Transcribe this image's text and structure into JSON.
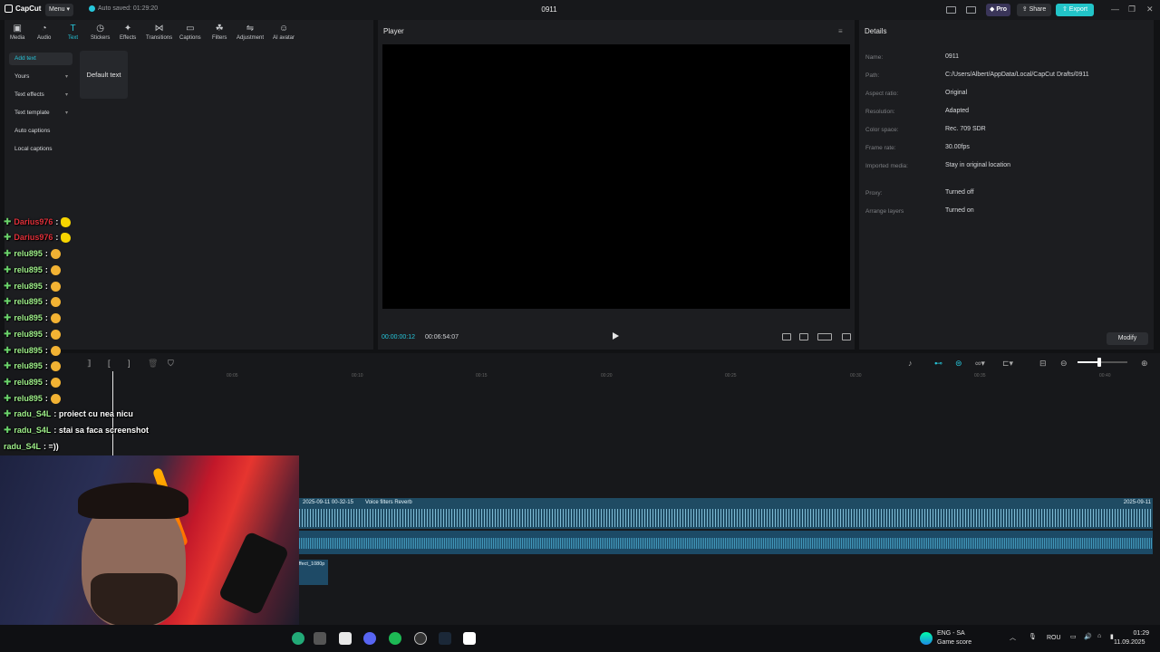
{
  "titlebar": {
    "app_name": "CapCut",
    "menu_label": "Menu",
    "autosave": "Auto saved: 01:29:20",
    "project_title": "0911",
    "pro_label": "Pro",
    "share_label": "Share",
    "export_label": "Export"
  },
  "toolbar": {
    "tabs": [
      {
        "label": "Media",
        "icon": "media-icon"
      },
      {
        "label": "Audio",
        "icon": "audio-icon"
      },
      {
        "label": "Text",
        "icon": "text-icon"
      },
      {
        "label": "Stickers",
        "icon": "stickers-icon"
      },
      {
        "label": "Effects",
        "icon": "effects-icon"
      },
      {
        "label": "Transitions",
        "icon": "transitions-icon"
      },
      {
        "label": "Captions",
        "icon": "captions-icon"
      },
      {
        "label": "Filters",
        "icon": "filters-icon"
      },
      {
        "label": "Adjustment",
        "icon": "adjustment-icon"
      },
      {
        "label": "AI avatar",
        "icon": "ai-avatar-icon"
      }
    ],
    "active_tab": "Text"
  },
  "sidebar": {
    "items": [
      {
        "label": "Add text",
        "selected": true
      },
      {
        "label": "Yours",
        "has_chevron": true
      },
      {
        "label": "Text effects",
        "has_chevron": true
      },
      {
        "label": "Text template",
        "has_chevron": true
      },
      {
        "label": "Auto captions"
      },
      {
        "label": "Local captions"
      }
    ]
  },
  "text_library": {
    "default_text_label": "Default text"
  },
  "player": {
    "title": "Player",
    "current_time": "00:00:00:12",
    "duration": "00:06:54:07"
  },
  "details": {
    "title": "Details",
    "rows": [
      {
        "label": "Name:",
        "value": "0911"
      },
      {
        "label": "Path:",
        "value": "C:/Users/Albert/AppData/Local/CapCut Drafts/0911"
      },
      {
        "label": "Aspect ratio:",
        "value": "Original"
      },
      {
        "label": "Resolution:",
        "value": "Adapted"
      },
      {
        "label": "Color space:",
        "value": "Rec. 709 SDR"
      },
      {
        "label": "Frame rate:",
        "value": "30.00fps"
      },
      {
        "label": "Imported media:",
        "value": "Stay in original location"
      },
      {
        "label": "Proxy:",
        "value": "Turned off"
      },
      {
        "label": "Arrange layers",
        "value": "Turned on"
      }
    ],
    "modify_label": "Modify"
  },
  "timeline": {
    "ticks": [
      "00:05",
      "00:10",
      "00:15",
      "00:20",
      "00:25",
      "00:30",
      "00:35",
      "00:40"
    ],
    "audio_clip": {
      "date_label": "2025-09-11 00-32-15",
      "effect_label": "Voice filters Reverb",
      "end_label": "2025-09-11"
    },
    "small_clip_label": "Effect_1080p"
  },
  "chat": [
    {
      "name": "Darius976",
      "name_color": "red",
      "text": ":",
      "emote": "yellow"
    },
    {
      "name": "Darius976",
      "name_color": "red",
      "text": ":",
      "emote": "yellow"
    },
    {
      "name": "relu895",
      "text": ":",
      "emote": "gold"
    },
    {
      "name": "relu895",
      "text": ":",
      "emote": "gold"
    },
    {
      "name": "relu895",
      "text": ":",
      "emote": "gold"
    },
    {
      "name": "relu895",
      "text": ":",
      "emote": "gold"
    },
    {
      "name": "relu895",
      "text": ":",
      "emote": "gold"
    },
    {
      "name": "relu895",
      "text": ":",
      "emote": "gold"
    },
    {
      "name": "relu895",
      "text": ":",
      "emote": "gold"
    },
    {
      "name": "relu895",
      "text": ":",
      "emote": "gold"
    },
    {
      "name": "relu895",
      "text": ":",
      "emote": "gold"
    },
    {
      "name": "relu895",
      "text": ":",
      "emote": "gold"
    },
    {
      "name": "radu_S4L",
      "text": ": proiect cu nea nicu"
    },
    {
      "name": "radu_S4L",
      "text": ": stai sa faca screenshot"
    },
    {
      "name": "radu_S4L",
      "text": ": =))",
      "no_plus": true
    }
  ],
  "taskbar": {
    "weather_line1": "ENG - SA",
    "weather_line2": "Game score",
    "lang": "ROU",
    "time": "01:29",
    "date": "11.09.2025"
  },
  "colors": {
    "accent": "#26c6da",
    "export": "#22c4c8",
    "clip": "#1f4b63"
  }
}
